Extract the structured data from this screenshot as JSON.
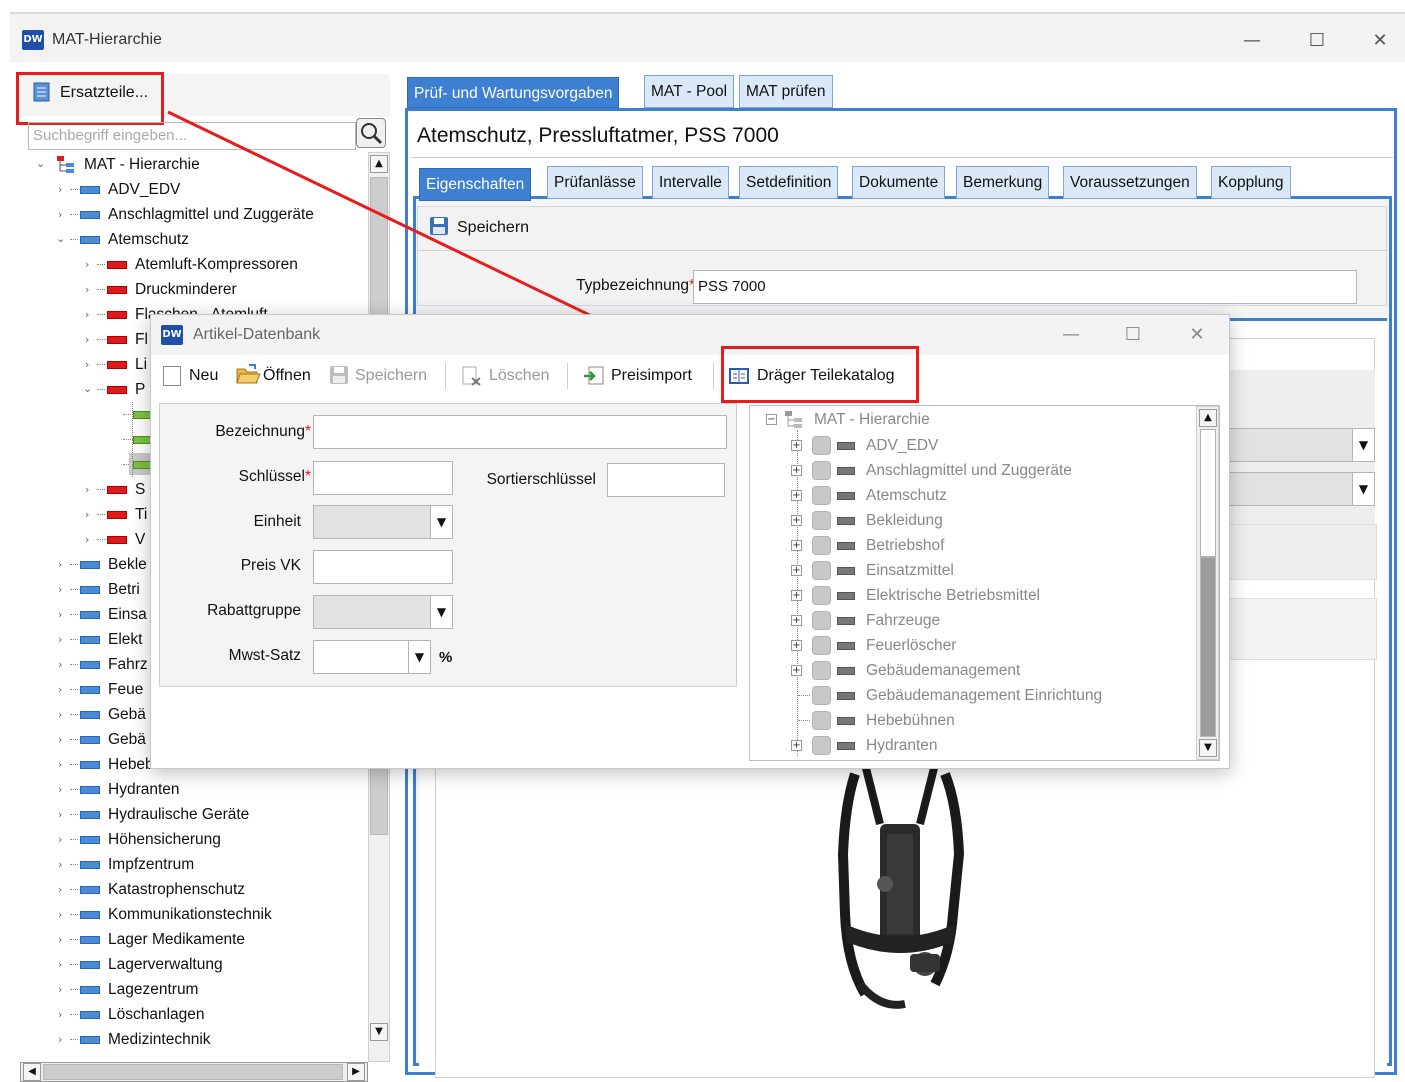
{
  "main": {
    "title": "MAT-Hierarchie",
    "logo": "DW",
    "window_buttons": {
      "minimize": "—",
      "maximize": "☐",
      "close": "✕"
    }
  },
  "left": {
    "ersatzteile_label": "Ersatzteile...",
    "search_placeholder": "Suchbegriff eingeben...",
    "tree_root": "MAT - Hierarchie",
    "items": [
      "ADV_EDV",
      "Anschlagmittel und Zuggeräte",
      "Atemschutz",
      "Atemluft-Kompressoren",
      "Druckminderer",
      "Flaschen - Atemluft",
      "Fl",
      "Li",
      "P",
      "",
      "",
      "",
      "S",
      "Ti",
      "V",
      "Bekle",
      "Betri",
      "Einsa",
      "Elekt",
      "Fahrz",
      "Feue",
      "Gebä",
      "Gebä",
      "Hebebühnen",
      "Hydranten",
      "Hydraulische Geräte",
      "Höhensicherung",
      "Impfzentrum",
      "Katastrophenschutz",
      "Kommunikationstechnik",
      "Lager Medikamente",
      "Lagerverwaltung",
      "Lagezentrum",
      "Löschanlagen",
      "Medizintechnik"
    ]
  },
  "right": {
    "top_tabs": [
      "Prüf- und Wartungsvorgaben",
      "MAT - Pool",
      "MAT prüfen"
    ],
    "item_title": "Atemschutz, Pressluftatmer, PSS 7000",
    "sub_tabs": [
      "Eigenschaften",
      "Prüfanlässe",
      "Intervalle",
      "Setdefinition",
      "Dokumente",
      "Bemerkung",
      "Voraussetzungen",
      "Kopplung"
    ],
    "save_label": "Speichern",
    "typ_label": "Typbezeichnung",
    "typ_value": "PSS 7000"
  },
  "dialog": {
    "title": "Artikel-Datenbank",
    "logo": "DW",
    "toolbar": {
      "neu": "Neu",
      "oeffnen": "Öffnen",
      "speichern": "Speichern",
      "loeschen": "Löschen",
      "preisimport": "Preisimport",
      "draeger": "Dräger Teilekatalog"
    },
    "form": {
      "bezeichnung": "Bezeichnung",
      "schluessel": "Schlüssel",
      "sortierschluessel": "Sortierschlüssel",
      "einheit": "Einheit",
      "preis_vk": "Preis VK",
      "rabattgruppe": "Rabattgruppe",
      "mwst_satz": "Mwst-Satz",
      "percent": "%"
    },
    "tree_root": "MAT - Hierarchie",
    "tree_items": [
      "ADV_EDV",
      "Anschlagmittel und Zuggeräte",
      "Atemschutz",
      "Bekleidung",
      "Betriebshof",
      "Einsatzmittel",
      "Elektrische Betriebsmittel",
      "Fahrzeuge",
      "Feuerlöscher",
      "Gebäudemanagement",
      "Gebäudemanagement Einrichtung",
      "Hebebühnen",
      "Hydranten"
    ],
    "tree_expandable": [
      true,
      true,
      true,
      true,
      true,
      true,
      true,
      true,
      true,
      true,
      false,
      false,
      true
    ]
  },
  "colors": {
    "highlight": "#e81c1c",
    "accent": "#3d7fd1"
  }
}
